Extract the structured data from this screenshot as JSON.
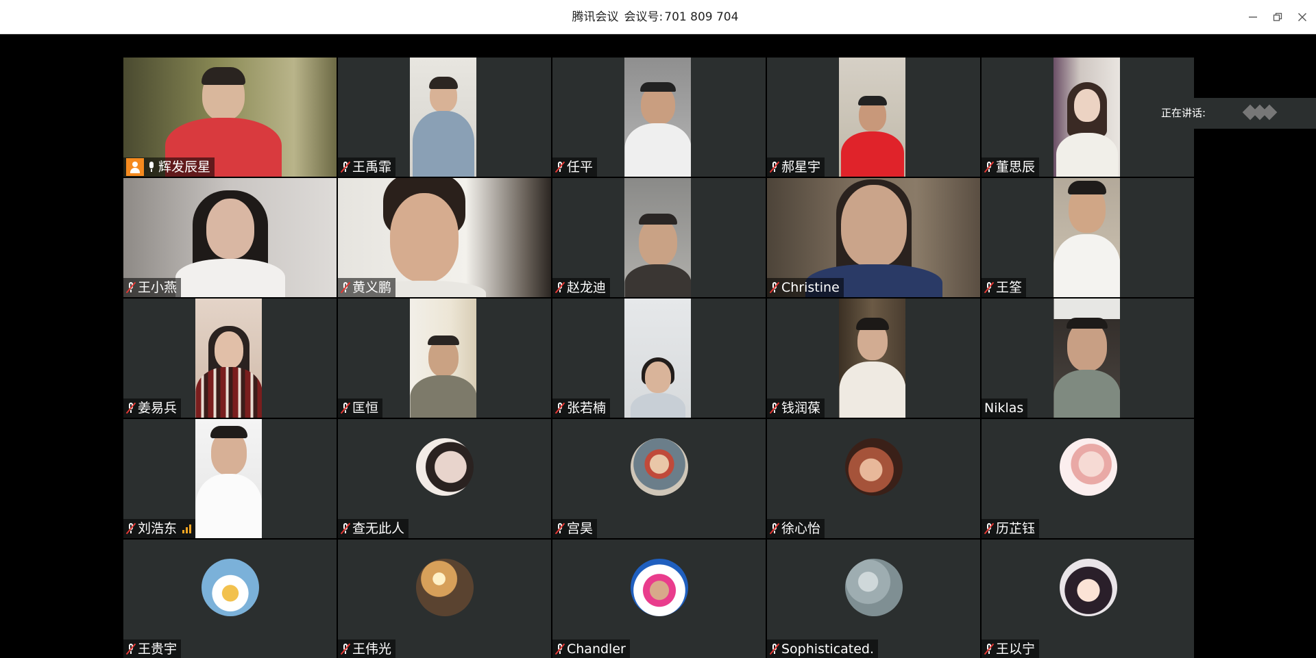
{
  "window": {
    "app_name": "腾讯会议",
    "meeting_id_label": "会议号:",
    "meeting_id": "701 809 704",
    "controls": [
      "minimize-icon",
      "restore-icon",
      "close-icon"
    ]
  },
  "speaking_panel": {
    "label": "正在讲话:"
  },
  "colors": {
    "tile_bg": "#2b2f2f",
    "host_badge": "#f58a1f",
    "muted_slash": "#e53935",
    "signal": "#f5a623"
  },
  "participants": [
    {
      "name": "辉发辰星",
      "mic": "on",
      "host": true
    },
    {
      "name": "王禹霏",
      "mic": "muted"
    },
    {
      "name": "任平",
      "mic": "muted"
    },
    {
      "name": "郝星宇",
      "mic": "muted"
    },
    {
      "name": "董思辰",
      "mic": "muted"
    },
    {
      "name": "王小燕",
      "mic": "muted"
    },
    {
      "name": "黄义鹏",
      "mic": "muted"
    },
    {
      "name": "赵龙迪",
      "mic": "muted"
    },
    {
      "name": "Christine",
      "mic": "muted"
    },
    {
      "name": "王筌",
      "mic": "muted"
    },
    {
      "name": "姜易兵",
      "mic": "muted"
    },
    {
      "name": "匡恒",
      "mic": "muted"
    },
    {
      "name": "张若楠",
      "mic": "muted"
    },
    {
      "name": "钱润葆",
      "mic": "muted"
    },
    {
      "name": "Niklas",
      "mic": "none"
    },
    {
      "name": "刘浩东",
      "mic": "muted",
      "signal": true
    },
    {
      "name": "查无此人",
      "mic": "muted"
    },
    {
      "name": "宫昊",
      "mic": "muted"
    },
    {
      "name": "徐心怡",
      "mic": "muted"
    },
    {
      "name": "历芷钰",
      "mic": "muted"
    },
    {
      "name": "王贵宇",
      "mic": "muted"
    },
    {
      "name": "王伟光",
      "mic": "muted"
    },
    {
      "name": "Chandler",
      "mic": "muted"
    },
    {
      "name": "Sophisticated.",
      "mic": "muted"
    },
    {
      "name": "王以宁",
      "mic": "muted"
    }
  ]
}
